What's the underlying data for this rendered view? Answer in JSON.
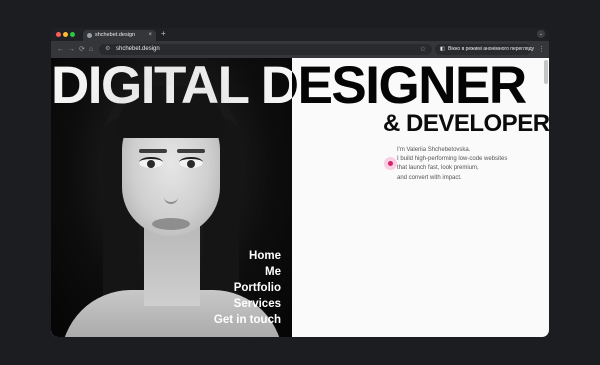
{
  "browser": {
    "tab": {
      "title": "shchebet.design",
      "close_label": "×"
    },
    "new_tab_label": "+",
    "tab_menu_label": "⌄",
    "nav": {
      "back": "←",
      "forward": "→",
      "reload": "⟳",
      "home": "⌂"
    },
    "omnibox": {
      "site_info_icon": "⚙",
      "url": "shchebet.design",
      "bookmark_icon": "☆"
    },
    "incognito_notice": {
      "icon": "◧",
      "text": "Вікно в режимі анонімного перегляду"
    },
    "menu_label": "⋮",
    "colors": {
      "window_dot_close": "#ff5f57",
      "window_dot_minimize": "#febc2e",
      "window_dot_zoom": "#28c840"
    }
  },
  "page": {
    "title_main": "DIGITAL DESIGNER",
    "title_sub": "& DEVELOPER",
    "nav_items": [
      "Home",
      "Me",
      "Portfolio",
      "Services",
      "Get in touch"
    ],
    "intro_lines": [
      "I'm Valeriia Shchebetovska.",
      "I build high-performing low-code websites",
      "that launch fast, look premium,",
      "and convert with impact."
    ],
    "colors": {
      "accent": "#d6246c",
      "accent_glow": "#f9cfe3",
      "background": "#fafafa",
      "text": "#0b0b0b"
    }
  }
}
